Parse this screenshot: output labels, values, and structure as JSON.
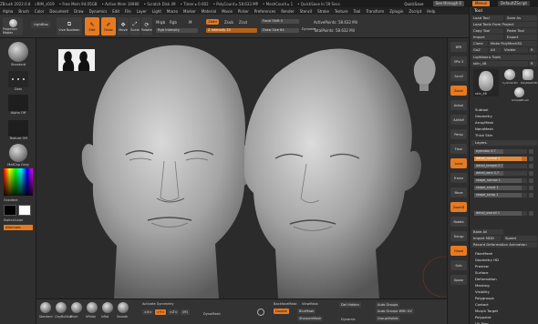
{
  "titlebar": {
    "app": "ZBrush 2022.0.8",
    "file": "cRIM_s019",
    "free_mem": "• Free Mem 94.05GB",
    "active_mem": "• Active Mem 16980",
    "scratch": "• Scratch Disk 49",
    "timer": "• Timer ▸ 0.002",
    "polycount": "• PolyCount ▸ 58.633 MP",
    "meshcount": "• MeshCount ▸ 1",
    "quicksave_timer": "• QuickSave In 59 Secs",
    "quicksave": "QuickSave",
    "see_through": "See-through 0",
    "menus_btn": "Menus",
    "default_script": "DefaultZScript"
  },
  "menubar": {
    "items": [
      "Alpha",
      "Brush",
      "Color",
      "Document",
      "Draw",
      "Dynamics",
      "Edit",
      "File",
      "Layer",
      "Light",
      "Macro",
      "Marker",
      "Material",
      "Movie",
      "Picker",
      "Preferences",
      "Render",
      "Stencil",
      "Stroke",
      "Texture",
      "Tool",
      "Transform",
      "Zplugin",
      "Zscript",
      "Help"
    ]
  },
  "shelf": {
    "projection_master": "Projection Master",
    "lightbox": "LightBox",
    "live_boolean": "Live Boolean",
    "edit": "Edit",
    "draw": "Draw",
    "move": "Move",
    "scale": "Scale",
    "rotate": "Rotate",
    "mrgb": "Mrgb",
    "rgb": "Rgb",
    "m": "M",
    "rgb_intensity": "Rgb Intensity",
    "zadd": "Zadd",
    "zsub": "Zsub",
    "zcut": "Zcut",
    "z_intensity": "Z Intensity 25",
    "focal_shift": "Focal Shift 0",
    "draw_size": "Draw Size 64",
    "dynamic": "Dynamic",
    "active_points": "ActivePoints: 58.632 Mil",
    "total_points": "TotalPoints: 58.632 Mil"
  },
  "lefttray": {
    "brush_label": "Standard",
    "stroke_label": "Dots",
    "alpha_label": "Alpha Off",
    "texture_label": "Texture Off",
    "material_label": "MatCap Gray",
    "gradient_label": "Gradient",
    "switch_color": "SwitchColor",
    "alternate": "Alternate"
  },
  "rightshelf": {
    "buttons": [
      "BPR",
      "SPix 3",
      "Scroll",
      "Zoom",
      "Actual",
      "AAHalf",
      "Persp",
      "Floor",
      "Local",
      "Frame",
      "Move",
      "ZoomD",
      "Rotate",
      "Transp",
      "Ghost",
      "Solo",
      "Xpose"
    ]
  },
  "toolpanel": {
    "title": "Tool",
    "load_tool": "Load Tool",
    "save_as": "Save As",
    "load_tools_from_project": "Load Tools From Project",
    "copy_tool": "Copy Tool",
    "paste_tool": "Paste Tool",
    "import": "Import",
    "export": "Export",
    "clone": "Clone",
    "make_polymesh": "Make PolyMesh3D",
    "goz": "GoZ",
    "all": "All",
    "visible": "Visible",
    "r": "R",
    "lightbox_tools": "Lightbox ▸ Tools",
    "skin_name": "skin_48",
    "r_btn": "R",
    "thumb_labels": [
      "skin_48",
      "Cylinder3D",
      "PolyMesh3D",
      "SimpleBrush"
    ],
    "sections": [
      "Subtool",
      "Geometry",
      "ArrayMesh",
      "NanoMesh",
      "Thick Skin"
    ],
    "layers_title": "Layers",
    "layers": [
      {
        "name": "eyeroton 0.7",
        "fill": 0.55
      },
      {
        "name": "detail_normal 1",
        "fill": 0.9
      },
      {
        "name": "detail_temple 0.7",
        "fill": 0.55
      },
      {
        "name": "detail_ears 0.7",
        "fill": 0.55
      },
      {
        "name": "shape_narrow 1",
        "fill": 0.9
      },
      {
        "name": "shape_snout 1",
        "fill": 0.9
      },
      {
        "name": "shape_scrop 1",
        "fill": 0.9
      },
      {
        "name": "detail_overall 1",
        "fill": 0.9
      }
    ],
    "bake_all": "Bake All",
    "import_mdd": "Import MDD",
    "speed": "Speed",
    "record_deformation": "Record Deformation Animation",
    "lower_sections": [
      "FiberMesh",
      "Geometry HD",
      "Preview",
      "Surface",
      "Deformation",
      "Masking",
      "Visibility",
      "Polygroups",
      "Contact",
      "Morph Target",
      "Polypaint",
      "UV Map"
    ]
  },
  "bottomshelf": {
    "sphere_labels": [
      "Standard",
      "ClayBuildup",
      "Pinch",
      "hPolish",
      "Inflat",
      "Smooth"
    ],
    "activate_symmetry": "Activate Symmetry",
    "sym_x": ">X<",
    "sym_y": ">Y<",
    "sym_z": ">Z<",
    "sym_m": "(M)",
    "dynamesh": "DynaMesh",
    "backface_mask": "BackfaceMask",
    "view_mask": "ViewMask",
    "double": "Double",
    "blur_mask": "BlurMask",
    "sharpen_mask": "SharpenMask",
    "del_hidden": "Del Hidden",
    "dynamic": "Dynamic",
    "auto_groups": "Auto Groups",
    "auto_groups_uv": "Auto Groups With UV",
    "group_visible": "GroupVisible"
  }
}
